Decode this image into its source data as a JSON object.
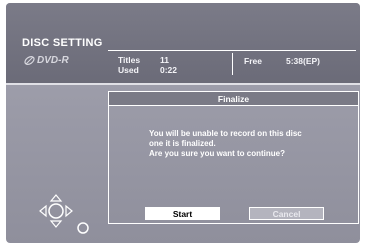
{
  "header": {
    "title": "DISC SETTING",
    "disc_type": "DVD-R",
    "stats": {
      "titles_label": "Titles",
      "titles_value": "11",
      "used_label": "Used",
      "used_value": "0:22",
      "free_label": "Free",
      "free_value": "5:38(EP)"
    }
  },
  "dialog": {
    "title": "Finalize",
    "message_line1": "You will be unable to record on this disc",
    "message_line2": "one it is finalized.",
    "message_line3": "Are you sure you want to continue?",
    "start_label": "Start",
    "cancel_label": "Cancel"
  },
  "icons": {
    "disc": "disc-icon",
    "nav": "directional-pad-icon",
    "enter": "enter-button-icon"
  },
  "colors": {
    "background": "#9a9aa7",
    "header": "#6f6f7c",
    "text": "#ffffff",
    "cancel_button": "#b4b4be"
  }
}
